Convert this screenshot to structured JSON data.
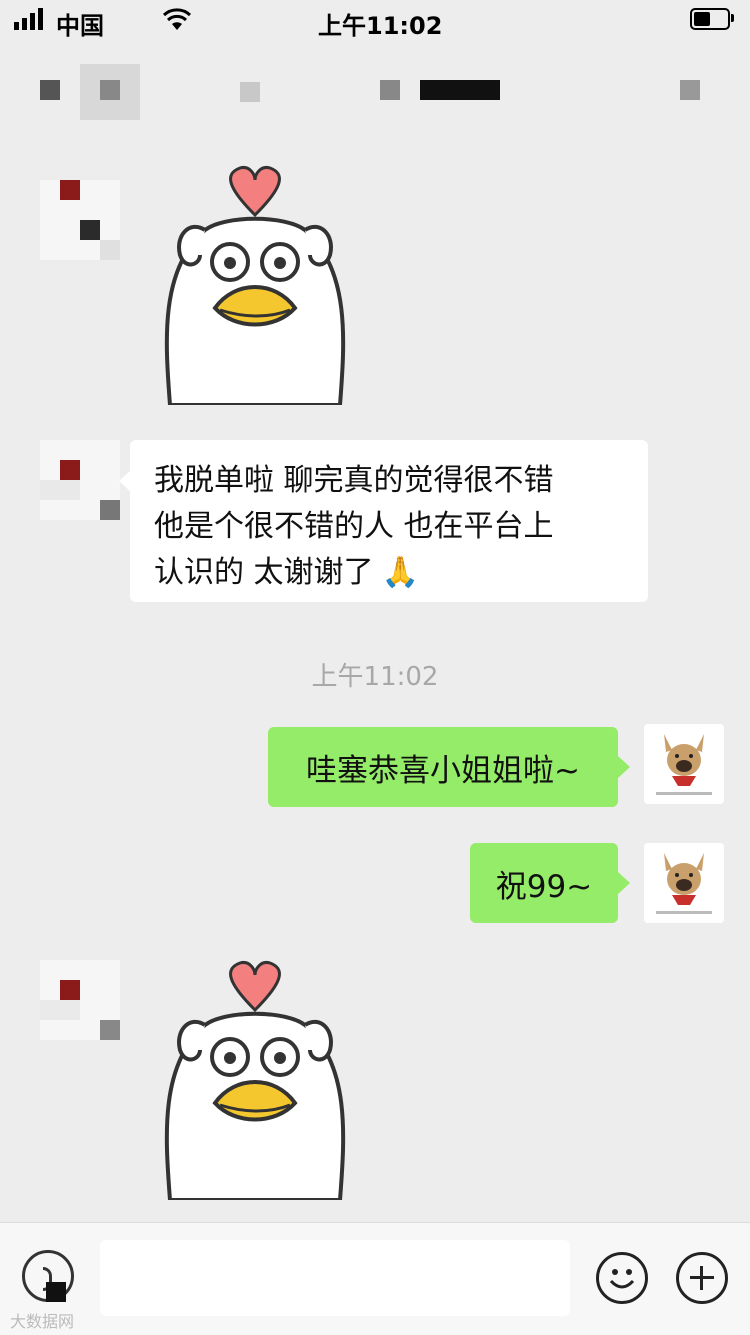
{
  "status_bar": {
    "carrier": "中国",
    "time": "上午11:02"
  },
  "messages": [
    {
      "from": "other",
      "type": "sticker",
      "sticker": "duck-heart-sticker"
    },
    {
      "from": "other",
      "type": "text",
      "lines": [
        "我脱单啦 聊完真的觉得很不错",
        "他是个很不错的人 也在平台上",
        "认识的 太谢谢了"
      ],
      "emoji": "🙏"
    },
    {
      "type": "timestamp",
      "text": "上午11:02"
    },
    {
      "from": "me",
      "type": "text",
      "text": "哇塞恭喜小姐姐啦~"
    },
    {
      "from": "me",
      "type": "text",
      "text": "祝99~"
    },
    {
      "from": "other",
      "type": "sticker",
      "sticker": "duck-heart-sticker"
    }
  ],
  "input_bar": {
    "voice_icon": "voice-icon",
    "emoji_icon": "smiley-icon",
    "more_icon": "plus-icon"
  },
  "watermark": "大数据网",
  "colors": {
    "background": "#ededed",
    "outgoing_bubble": "#95ec69",
    "incoming_bubble": "#ffffff",
    "heart": "#f37f7f",
    "beak": "#f5c72e"
  }
}
